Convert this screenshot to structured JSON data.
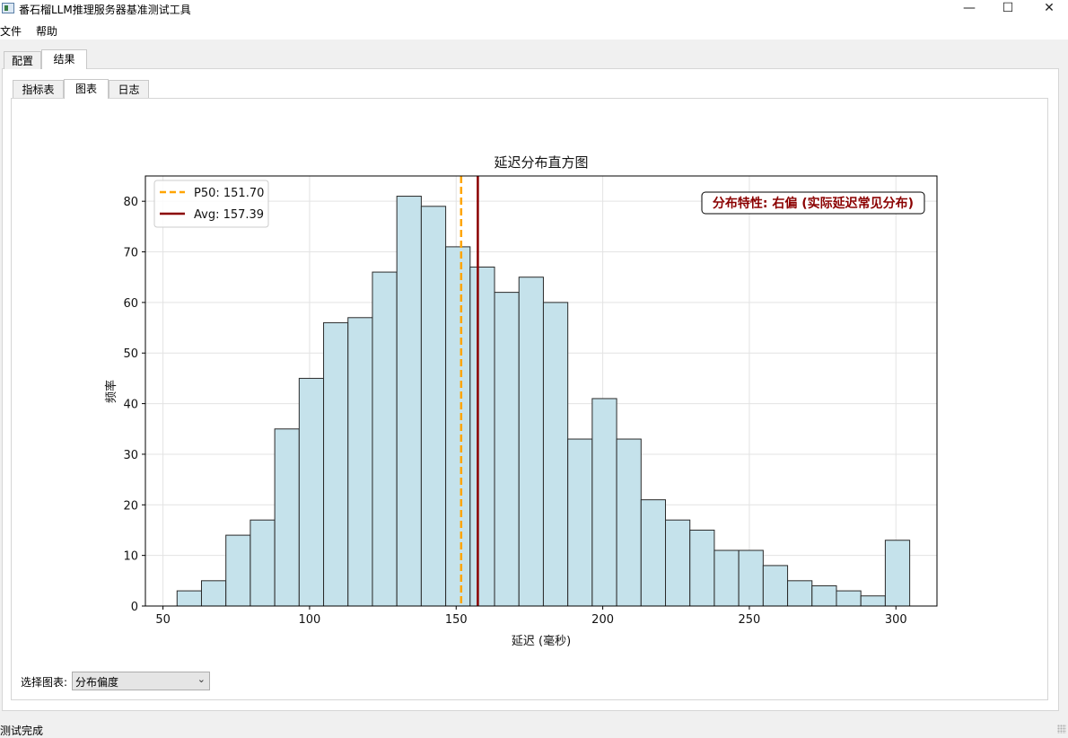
{
  "window": {
    "title": "番石榴LLM推理服务器基准测试工具"
  },
  "menu": [
    "文件",
    "帮助"
  ],
  "outer_tabs": [
    {
      "label": "配置",
      "active": false
    },
    {
      "label": "结果",
      "active": true
    }
  ],
  "inner_tabs": [
    {
      "label": "指标表",
      "active": false
    },
    {
      "label": "图表",
      "active": true
    },
    {
      "label": "日志",
      "active": false
    }
  ],
  "chart_selector": {
    "label": "选择图表:",
    "value": "分布偏度"
  },
  "status": {
    "text": "测试完成"
  },
  "colors": {
    "bar_fill": "#c5e2eb",
    "bar_edge": "#2a2a2a",
    "p50": "#ffa500",
    "avg": "#8b0000",
    "annotation": "#8b0000"
  },
  "chart_data": {
    "type": "bar",
    "title": "延迟分布直方图",
    "xlabel": "延迟 (毫秒)",
    "ylabel": "频率",
    "xlim": [
      44,
      314
    ],
    "ylim": [
      0,
      85
    ],
    "x_ticks": [
      50,
      100,
      150,
      200,
      250,
      300
    ],
    "y_ticks": [
      0,
      10,
      20,
      30,
      40,
      50,
      60,
      70,
      80
    ],
    "bin_start": 54.8,
    "bin_width": 8.33,
    "values": [
      3,
      5,
      14,
      17,
      35,
      45,
      56,
      57,
      66,
      81,
      79,
      71,
      67,
      62,
      65,
      60,
      33,
      41,
      33,
      21,
      17,
      15,
      11,
      11,
      8,
      5,
      4,
      3,
      2,
      13
    ],
    "grid": true,
    "vlines": [
      {
        "label": "P50: 151.70",
        "x": 151.7,
        "style": "dashed",
        "color": "#ffa500"
      },
      {
        "label": "Avg: 157.39",
        "x": 157.39,
        "style": "solid",
        "color": "#8b0000"
      }
    ],
    "legend_position": "top-left",
    "annotation": {
      "text": "分布特性: 右偏 (实际延迟常见分布)",
      "position": "top-right"
    }
  }
}
